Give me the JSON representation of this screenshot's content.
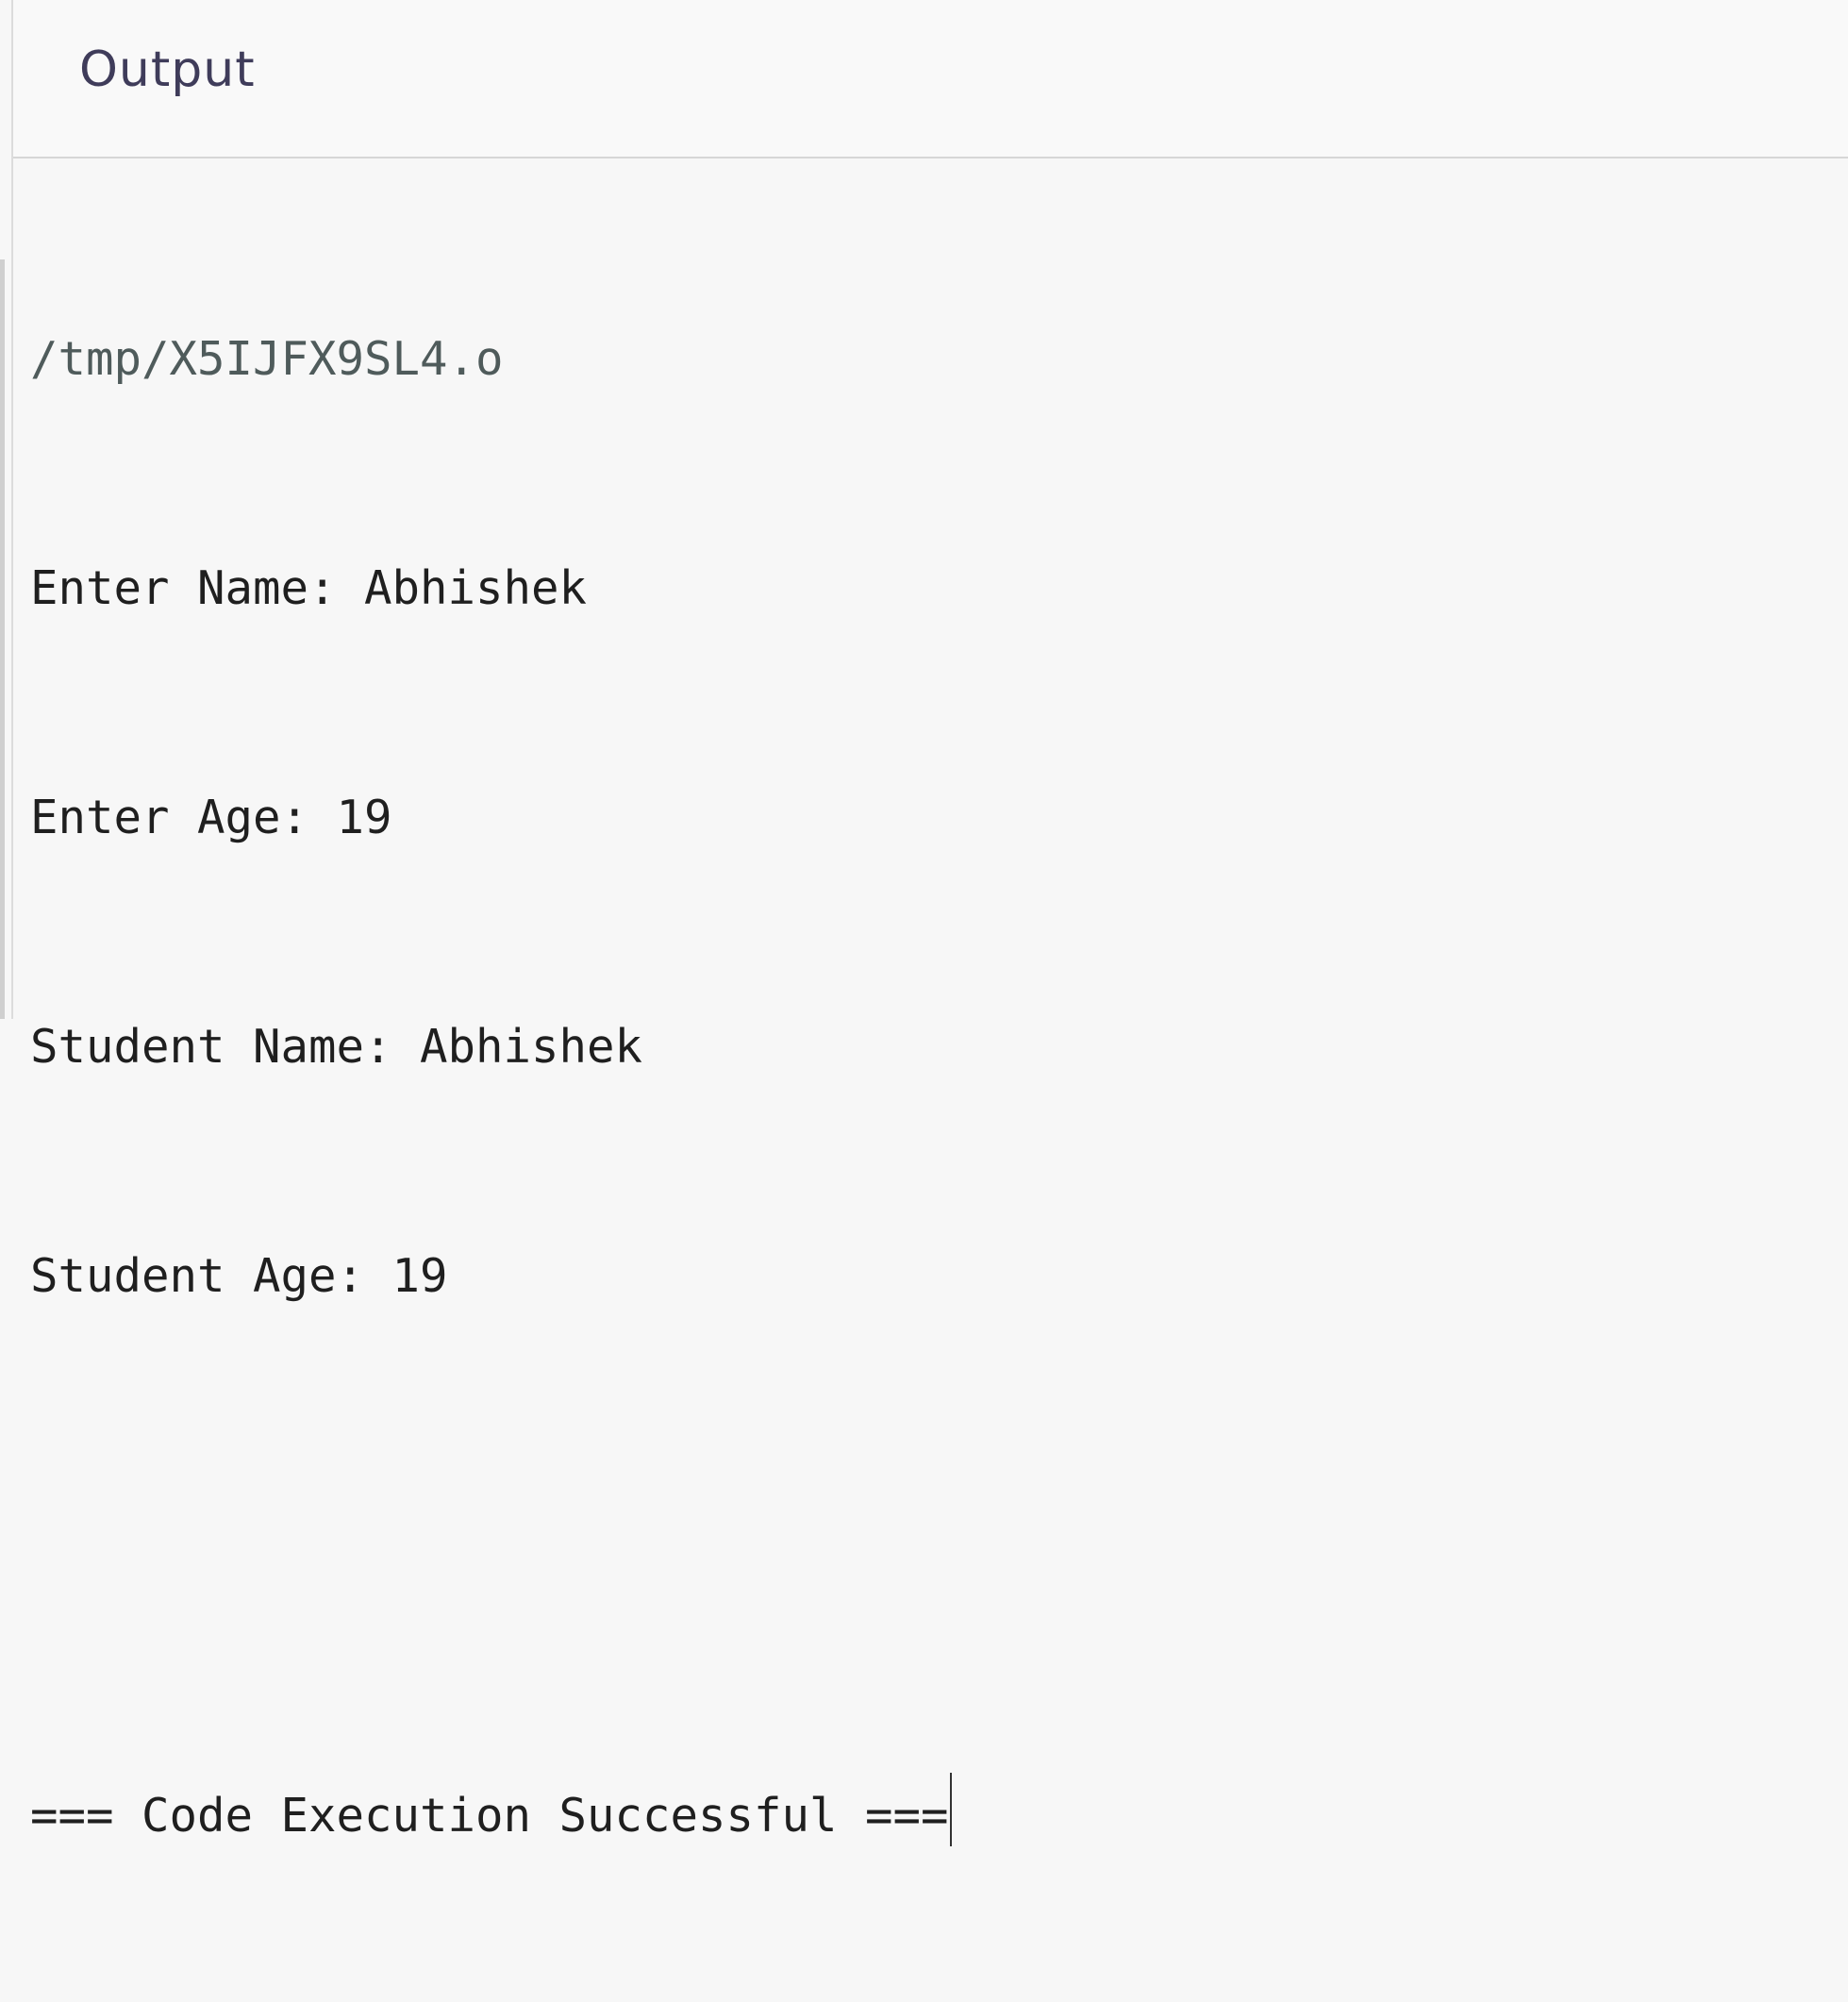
{
  "header": {
    "title": "Output"
  },
  "console": {
    "path": "/tmp/X5IJFX9SL4.o",
    "lines": [
      "Enter Name: Abhishek",
      "Enter Age: 19",
      "Student Name: Abhishek",
      "Student Age: 19"
    ],
    "status": "=== Code Execution Successful ==="
  }
}
